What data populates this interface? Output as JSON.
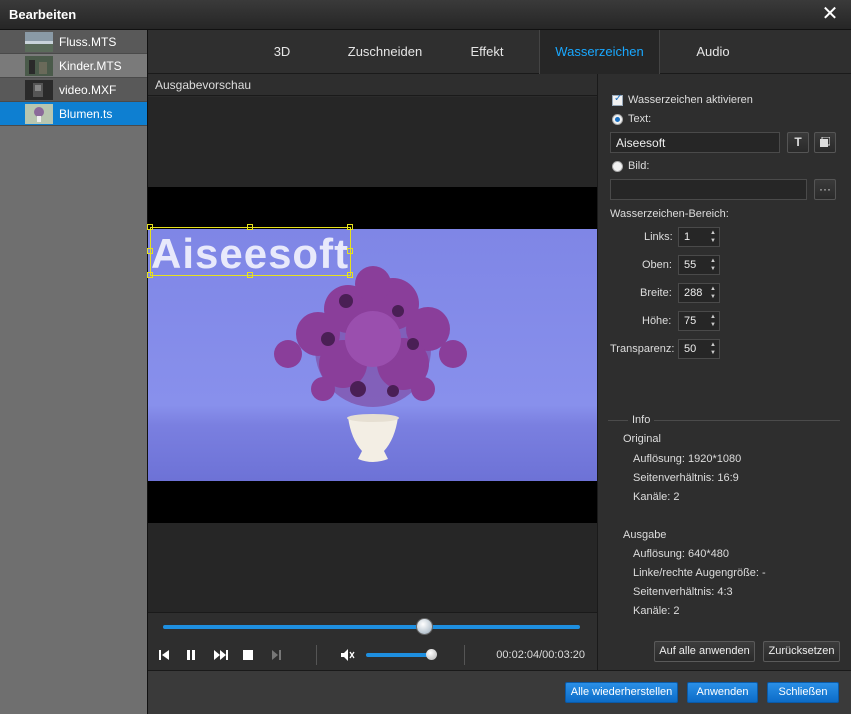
{
  "window": {
    "title": "Bearbeiten"
  },
  "files": [
    {
      "name": "Fluss.MTS",
      "state": "normal"
    },
    {
      "name": "Kinder.MTS",
      "state": "hover"
    },
    {
      "name": "video.MXF",
      "state": "normal"
    },
    {
      "name": "Blumen.ts",
      "state": "active"
    }
  ],
  "tabs": [
    {
      "label": "3D"
    },
    {
      "label": "Zuschneiden"
    },
    {
      "label": "Effekt"
    },
    {
      "label": "Wasserzeichen",
      "active": true
    },
    {
      "label": "Audio"
    }
  ],
  "preview": {
    "header": "Ausgabevorschau",
    "watermark_text": "Aiseesoft"
  },
  "player": {
    "time": "00:02:04/00:03:20",
    "progress": 0.625,
    "volume": 0.9
  },
  "watermark": {
    "enable_label": "Wasserzeichen aktivieren",
    "enabled": true,
    "text_label": "Text:",
    "text_value": "Aiseesoft",
    "image_label": "Bild:",
    "image_value": "",
    "browse_label": "···",
    "area_label": "Wasserzeichen-Bereich:",
    "fields": [
      {
        "label": "Links:",
        "value": "1"
      },
      {
        "label": "Oben:",
        "value": "55"
      },
      {
        "label": "Breite:",
        "value": "288"
      },
      {
        "label": "Höhe:",
        "value": "75"
      },
      {
        "label": "Transparenz:",
        "value": "50"
      }
    ]
  },
  "info": {
    "title": "Info",
    "original_title": "Original",
    "original": [
      "Auflösung: 1920*1080",
      "Seitenverhältnis: 16:9",
      "Kanäle: 2"
    ],
    "output_title": "Ausgabe",
    "output": [
      "Auflösung: 640*480",
      "Linke/rechte Augengröße: -",
      "Seitenverhältnis: 4:3",
      "Kanäle: 2"
    ]
  },
  "buttons": {
    "apply_all": "Auf alle anwenden",
    "reset": "Zurücksetzen",
    "restore_all": "Alle wiederherstellen",
    "apply": "Anwenden",
    "close": "Schließen"
  },
  "colors": {
    "accent": "#0e7fd1",
    "tab_active": "#19a8ff",
    "handle": "#e7e21c"
  }
}
